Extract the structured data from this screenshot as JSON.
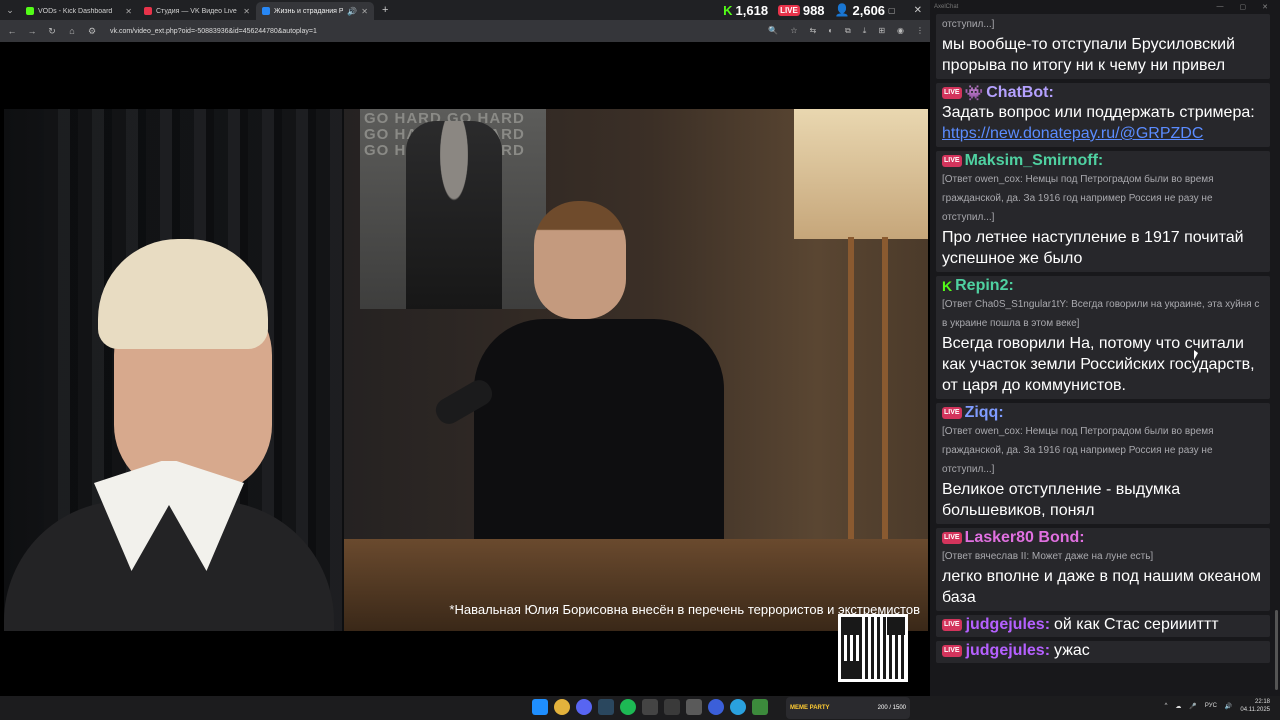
{
  "browser": {
    "tabs": [
      {
        "title": "VODs - Kick Dashboard",
        "color": "#53fc18",
        "active": false
      },
      {
        "title": "Студия — VK Видео Live",
        "color": "#e8334a",
        "active": false
      },
      {
        "title": "Жизнь и страдания Романа",
        "color": "#2787f5",
        "active": true
      }
    ],
    "url": "vk.com/video_ext.php?oid=-50883936&id=456244780&autoplay=1",
    "stats": {
      "kick": "1,618",
      "vk": "988",
      "viewers": "2,606",
      "vk_badge": "LIVE"
    }
  },
  "video": {
    "poster_text": "GO HARD GO HARD GO HARD GO HARD GO HARD GO HARD",
    "subtitle": "*Навальная Юлия Борисовна внесён в перечень террористов и экстремистов"
  },
  "chat": {
    "title": "AxelChat",
    "messages": [
      {
        "reply": "отступил...]",
        "text": "мы вообще-то отступали Брусиловский прорыва по итогу ни к чему ни привел",
        "continuation": true
      },
      {
        "platform": "live",
        "bot": true,
        "user": "ChatBot:",
        "color": "#b5a1ff",
        "text": "Задать вопрос или поддержать стримера:",
        "link": "https://new.donatepay.ru/@GRPZDC"
      },
      {
        "platform": "live",
        "user": "Maksim_Smirnoff:",
        "color": "#4fd1a1",
        "reply": "[Ответ owen_cox: Немцы под Петроградом были во время гражданской, да. За 1916 год например Россия не разу не отступил...]",
        "text": "Про летнее наступление в 1917 почитай успешное же было"
      },
      {
        "platform": "kick",
        "user": "Repin2:",
        "color": "#4fd1a1",
        "reply": "[Ответ Cha0S_S1ngular1tY: Всегда говорили на украине, эта хуйня с в украине пошла в этом веке]",
        "text": "Всегда говорили На, потому что считали как участок земли Российских государств, от царя до коммунистов."
      },
      {
        "platform": "live",
        "user": "Ziqq:",
        "color": "#7f9cff",
        "reply": "[Ответ owen_cox: Немцы под Петроградом были во время гражданской, да. За 1916 год например Россия не разу не отступил...]",
        "text": "Великое отступление - выдумка большевиков, понял"
      },
      {
        "platform": "live",
        "user": "Lasker80 Bond:",
        "color": "#e070e0",
        "reply": "[Ответ вячеслав II: Может даже на луне есть]",
        "text": "легко вполне и даже в под нашим океаном база"
      },
      {
        "platform": "live",
        "user": "judgejules:",
        "color": "#b560ff",
        "text": "ой как Стас сериииттт",
        "inline": true
      },
      {
        "platform": "live",
        "user": "judgejules:",
        "color": "#b560ff",
        "text": "ужас",
        "inline": true
      }
    ]
  },
  "taskbar": {
    "memes_label": "MEME PARTY",
    "memes_count": "200 / 1500",
    "lang": "РУС",
    "time": "22:18",
    "date": "04.11.2025"
  }
}
